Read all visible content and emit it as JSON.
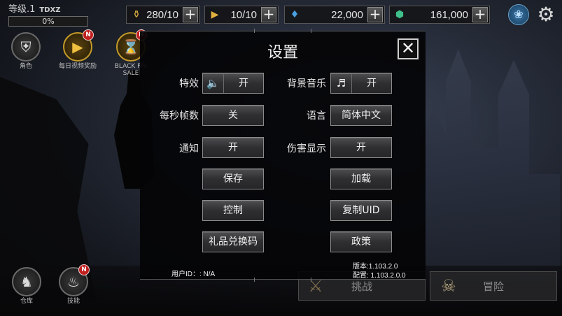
{
  "player": {
    "level": "等级.1",
    "name": "TDXZ",
    "xp_percent": "0%",
    "xp_fraction": 0.0
  },
  "resources": {
    "gold": {
      "value": "280/10",
      "icon": "gold-coin-icon"
    },
    "video": {
      "value": "10/10",
      "icon": "video-ticket-icon"
    },
    "blue": {
      "value": "22,000",
      "icon": "blue-crystal-icon"
    },
    "green": {
      "value": "161,000",
      "icon": "green-gem-icon"
    }
  },
  "side_icons": {
    "role": "角色",
    "daily_video": "每日视频奖励",
    "black_friday": "BLACK FRI SALE",
    "warehouse": "仓库",
    "skills": "技能",
    "badge": "N"
  },
  "bottom": {
    "challenge": "挑战",
    "adventure": "冒险"
  },
  "dialog": {
    "title": "设置",
    "close": "✕",
    "rows": {
      "effects_label": "特效",
      "effects_value": "开",
      "bgm_label": "背景音乐",
      "bgm_value": "开",
      "fps_label": "每秒帧数",
      "fps_value": "关",
      "language_label": "语言",
      "language_value": "简体中文",
      "notify_label": "通知",
      "notify_value": "开",
      "damage_label": "伤害显示",
      "damage_value": "开"
    },
    "buttons": {
      "save": "保存",
      "load": "加载",
      "control": "控制",
      "copy_uid": "复制UID",
      "gift_code": "礼品兑换码",
      "policy": "政策"
    },
    "user_id": "用户ID：: N/A",
    "version": "版本:1.103.2.0",
    "config": "配置: 1.103.2.0.0"
  }
}
